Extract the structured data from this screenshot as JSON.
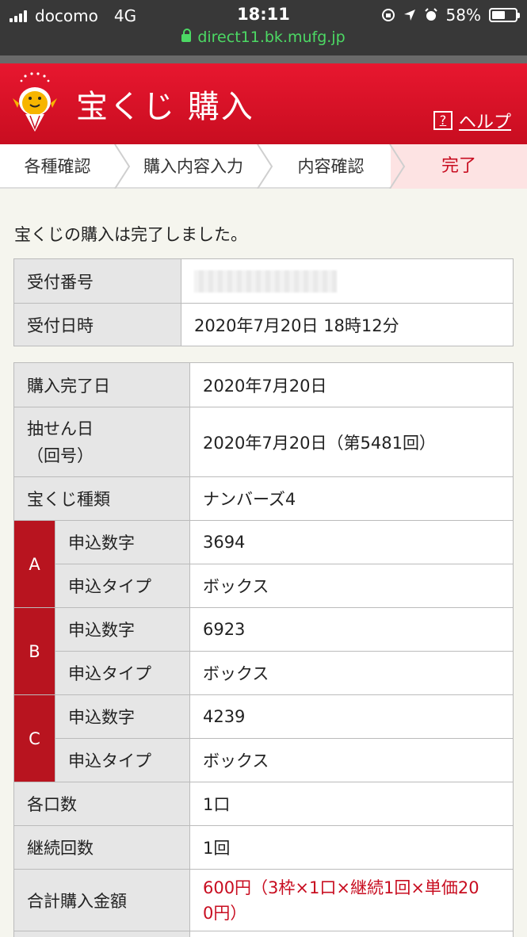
{
  "status_bar": {
    "carrier": "docomo",
    "network": "4G",
    "time": "18:11",
    "battery": "58%",
    "battery_level": 0.58,
    "url": "direct11.bk.mufg.jp"
  },
  "header": {
    "title": "宝くじ 購入",
    "help_icon": "?",
    "help_label": "ヘルプ"
  },
  "steps": [
    "各種確認",
    "購入内容入力",
    "内容確認",
    "完了"
  ],
  "message": "宝くじの購入は完了しました。",
  "receipt": {
    "number_label": "受付番号",
    "datetime_label": "受付日時",
    "datetime_value": "2020年7月20日 18時12分"
  },
  "details": {
    "completion_date_label": "購入完了日",
    "completion_date_value": "2020年7月20日",
    "draw_date_label_1": "抽せん日",
    "draw_date_label_2": "（回号）",
    "draw_date_value": "2020年7月20日（第5481回）",
    "lottery_type_label": "宝くじ種類",
    "lottery_type_value": "ナンバーズ4",
    "entries": [
      {
        "group": "A",
        "number_label": "申込数字",
        "number_value": "3694",
        "type_label": "申込タイプ",
        "type_value": "ボックス"
      },
      {
        "group": "B",
        "number_label": "申込数字",
        "number_value": "6923",
        "type_label": "申込タイプ",
        "type_value": "ボックス"
      },
      {
        "group": "C",
        "number_label": "申込数字",
        "number_value": "4239",
        "type_label": "申込タイプ",
        "type_value": "ボックス"
      }
    ],
    "units_label": "各口数",
    "units_value": "1口",
    "continuation_label": "継続回数",
    "continuation_value": "1回",
    "total_label": "合計購入金額",
    "total_value_line1": "600円（3枠×1口×継続1回×単価20",
    "total_value_line2": "0円）"
  }
}
